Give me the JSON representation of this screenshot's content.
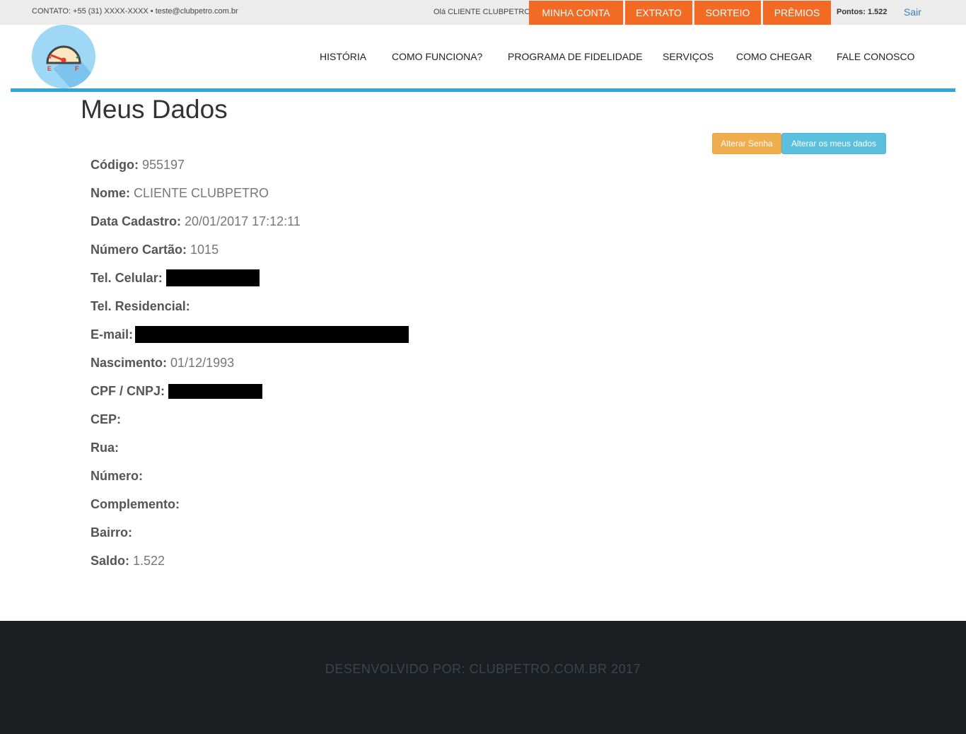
{
  "topbar": {
    "contact": "CONTATO: +55 (31) XXXX-XXXX • teste@clubpetro.com.br",
    "greeting": "Olá CLIENTE CLUBPETRO",
    "buttons": [
      "MINHA CONTA",
      "EXTRATO",
      "SORTEIO",
      "PRÊMIOS"
    ],
    "points": "Pontos: 1.522",
    "logout": "Sair"
  },
  "logo": {
    "gauge_empty": "E",
    "gauge_full": "F"
  },
  "nav": [
    "HISTÓRIA",
    "COMO FUNCIONA?",
    "PROGRAMA DE FIDELIDADE",
    "SERVIÇOS",
    "COMO CHEGAR",
    "FALE CONOSCO"
  ],
  "main": {
    "title": "Meus Dados",
    "btn_change_password": "Alterar Senha",
    "btn_change_data": "Alterar os meus dados",
    "fields": [
      {
        "label": "Código:",
        "value": "955197"
      },
      {
        "label": "Nome:",
        "value": "CLIENTE CLUBPETRO"
      },
      {
        "label": "Data Cadastro:",
        "value": "20/01/2017 17:12:11"
      },
      {
        "label": "Número Cartão:",
        "value": "1015"
      },
      {
        "label": "Tel. Celular:",
        "value": ""
      },
      {
        "label": "Tel. Residencial:",
        "value": ""
      },
      {
        "label": "E-mail:",
        "value": ""
      },
      {
        "label": "Nascimento:",
        "value": "01/12/1993"
      },
      {
        "label": "CPF / CNPJ:",
        "value": ""
      },
      {
        "label": "CEP:",
        "value": ""
      },
      {
        "label": "Rua:",
        "value": ""
      },
      {
        "label": "Número:",
        "value": ""
      },
      {
        "label": "Complemento:",
        "value": ""
      },
      {
        "label": "Bairro:",
        "value": ""
      },
      {
        "label": "Saldo:",
        "value": "1.522"
      }
    ]
  },
  "footer": {
    "credit": "DESENVOLVIDO POR: CLUBPETRO.COM.BR 2017"
  },
  "colors": {
    "accent_orange": "#f26a24",
    "header_line": "#2fa4df",
    "footer_bg": "#1b1f22"
  }
}
